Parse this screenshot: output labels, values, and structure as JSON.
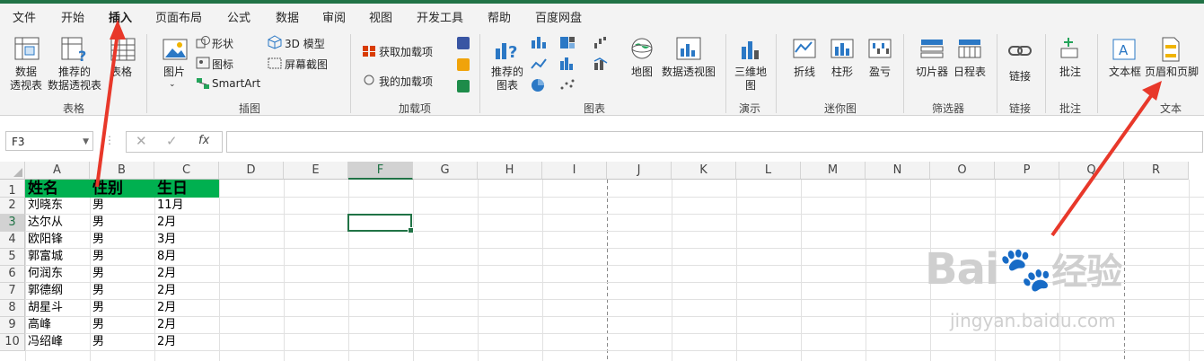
{
  "menu": {
    "tabs": [
      "文件",
      "开始",
      "插入",
      "页面布局",
      "公式",
      "数据",
      "审阅",
      "视图",
      "开发工具",
      "帮助",
      "百度网盘"
    ],
    "active": "插入"
  },
  "ribbon": {
    "tables": {
      "pivot": "数据\n透视表",
      "recommended_pivot": "推荐的\n数据透视表",
      "table": "表格",
      "group": "表格"
    },
    "illustrations": {
      "pictures": "图片",
      "shapes": "形状",
      "icons": "图标",
      "smartart": "SmartArt",
      "model3d": "3D 模型",
      "screenshot": "屏幕截图",
      "group": "插图"
    },
    "addins": {
      "get": "获取加载项",
      "my": "我的加载项",
      "group": "加载项"
    },
    "charts": {
      "recommended": "推荐的\n图表",
      "maps": "地图",
      "pivotchart": "数据透视图",
      "group": "图表"
    },
    "tours": {
      "map3d": "三维地\n图",
      "group": "演示"
    },
    "sparklines": {
      "line": "折线",
      "column": "柱形",
      "winloss": "盈亏",
      "group": "迷你图"
    },
    "filters": {
      "slicer": "切片器",
      "timeline": "日程表",
      "group": "筛选器"
    },
    "links": {
      "link": "链接",
      "group": "链接"
    },
    "comments": {
      "comment": "批注",
      "group": "批注"
    },
    "text": {
      "textbox": "文本框",
      "header_footer": "页眉和页脚",
      "group": "文本"
    }
  },
  "formula_bar": {
    "name_box": "F3",
    "fx": "fx",
    "value": ""
  },
  "columns": [
    "A",
    "B",
    "C",
    "D",
    "E",
    "F",
    "G",
    "H",
    "I",
    "J",
    "K",
    "L",
    "M",
    "N",
    "O",
    "P",
    "Q",
    "R"
  ],
  "selected_column": "F",
  "selected_row": 3,
  "rows": [
    {
      "n": "1",
      "a": "姓名",
      "b": "性别",
      "c": "生日"
    },
    {
      "n": "2",
      "a": "刘晓东",
      "b": "男",
      "c": "11月"
    },
    {
      "n": "3",
      "a": "达尔从",
      "b": "男",
      "c": "2月"
    },
    {
      "n": "4",
      "a": "欧阳锋",
      "b": "男",
      "c": "3月"
    },
    {
      "n": "5",
      "a": "郭富城",
      "b": "男",
      "c": "8月"
    },
    {
      "n": "6",
      "a": "何润东",
      "b": "男",
      "c": "2月"
    },
    {
      "n": "7",
      "a": "郭德纲",
      "b": "男",
      "c": "2月"
    },
    {
      "n": "8",
      "a": "胡星斗",
      "b": "男",
      "c": "2月"
    },
    {
      "n": "9",
      "a": "高峰",
      "b": "男",
      "c": "2月"
    },
    {
      "n": "10",
      "a": "冯绍峰",
      "b": "男",
      "c": "2月"
    }
  ],
  "colors": {
    "accent": "#217346",
    "header_fill": "#00b050",
    "annotation": "#e8382a"
  },
  "watermark": {
    "brand": "Bai",
    "brand2": "经验",
    "url": "jingyan.baidu.com"
  }
}
